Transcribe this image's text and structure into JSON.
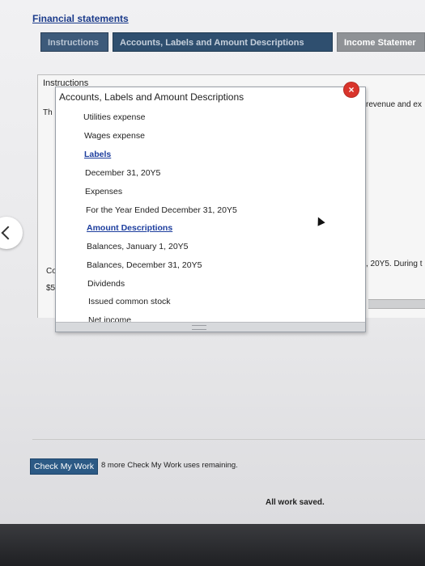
{
  "page": {
    "title": "Financial statements"
  },
  "tabs": [
    {
      "label": "Instructions"
    },
    {
      "label": "Accounts, Labels and Amount Descriptions"
    },
    {
      "label": "Income Statemer"
    }
  ],
  "panel": {
    "title": "Instructions",
    "fragments": {
      "th": "Th",
      "revenue": "revenue and ex",
      "co": "Co",
      "dollar": "$5",
      "year": ", 20Y5. During t"
    }
  },
  "popup": {
    "title": "Accounts, Labels and Amount Descriptions",
    "items": [
      {
        "text": "Utilities expense",
        "heading": false
      },
      {
        "text": "Wages expense",
        "heading": false
      },
      {
        "text": "Labels",
        "heading": true
      },
      {
        "text": "December 31, 20Y5",
        "heading": false
      },
      {
        "text": "Expenses",
        "heading": false
      },
      {
        "text": "For the Year Ended December 31, 20Y5",
        "heading": false
      },
      {
        "text": "Amount Descriptions",
        "heading": true
      },
      {
        "text": "Balances, January 1, 20Y5",
        "heading": false
      },
      {
        "text": "Balances, December 31, 20Y5",
        "heading": false
      },
      {
        "text": "Dividends",
        "heading": false
      },
      {
        "text": "Issued common stock",
        "heading": false
      },
      {
        "text": "Net income",
        "heading": false
      }
    ],
    "close_symbol": "×"
  },
  "footer": {
    "check_button": "Check My Work",
    "remaining": "8 more Check My Work uses remaining.",
    "saved": "All work saved."
  },
  "icons": {
    "close": "close-icon",
    "back": "chevron-left-icon",
    "cursor": "mouse-pointer-icon"
  }
}
